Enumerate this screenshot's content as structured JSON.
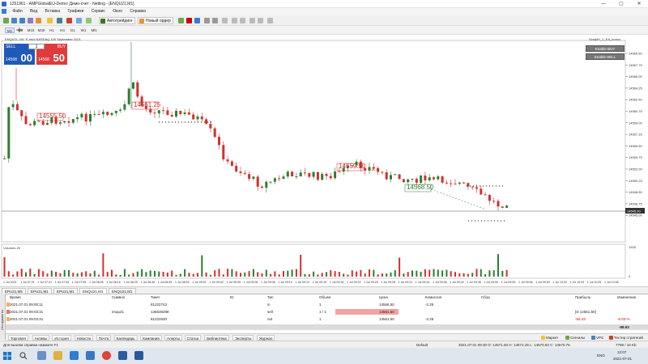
{
  "window": {
    "title": "1251961 - AMPGlobalEU-Demo: Демо-счет - Netting - [ENQU21,M1]",
    "minimize": "—",
    "maximize": "▢",
    "close": "✕"
  },
  "menu": [
    "Файл",
    "Вид",
    "Вставка",
    "Графики",
    "Сервис",
    "Окно",
    "Справка"
  ],
  "toolbar": {
    "autotrading": "Автотрейдинг",
    "new_order": "Новый ордер"
  },
  "timeframes": [
    "M1",
    "M5",
    "M15",
    "M30",
    "H1",
    "H4",
    "D1",
    "W1",
    "MN"
  ],
  "chart": {
    "title": "ENQU21, M1: E-mini NASDAQ 100 September 2021",
    "ea_label": "ScalpEr_2_EA_bonus",
    "enable_buy": "Enable BUY",
    "enable_sell": "Enable SELL",
    "volume_label": "Volumes 29",
    "oneclick": {
      "sell": "SELL",
      "buy": "BUY",
      "lot": "1",
      "sell_small": "14568",
      "sell_big": "00",
      "buy_small": "14568",
      "buy_big": "50"
    },
    "price_axis": [
      "14569.50",
      "14567.75",
      "14566.00",
      "14564.25",
      "14562.50",
      "14560.75",
      "14559.00",
      "14557.25",
      "14555.50",
      "14553.75",
      "14552.00",
      "14550.25",
      "14548.50",
      "14546.75",
      "14545.00"
    ],
    "current_price": "14545.00",
    "vol_axis": [
      "1925",
      "0"
    ],
    "time_axis": [
      "1 Jul 2021",
      "1 Jul 07:21",
      "1 Jul 07:41",
      "1 Jul 07:50",
      "1 Jul 07:59",
      "1 Jul 08:06",
      "1 Jul 08:16",
      "1 Jul 08:25",
      "1 Jul 08:36",
      "1 Jul 08:45",
      "1 Jul 08:53",
      "1 Jul 09:01",
      "1 Jul 09:02",
      "1 Jul 09:05",
      "1 Jul 09:06",
      "1 Jul 09:08",
      "1 Jul 09:10",
      "1 Jul 09:13",
      "1 Jul 09:15",
      "1 Jul 09:18",
      "1 Jul 09:22",
      "1 Jul 09:25",
      "1 Jul 09:28",
      "1 Jul 09:31",
      "1 Jul 09:34",
      "1 Jul 09:38",
      "1 Jul 09:42",
      "1 Jul 09:46",
      "1 Jul 09:50",
      "1 Jul 09:53",
      "1 Jul 09:56",
      "1 Jul 09:59",
      "1 Jul 10:02",
      "1 Jul 10:04",
      "1 Jul 10:05",
      "1 Jul 10:06"
    ],
    "trade_labels": [
      "14555.50",
      "14561.25",
      "14559.50",
      "14568.50"
    ]
  },
  "chart_tabs": [
    "EPU21,M5",
    "EPU21,M1",
    "EPU21,M1",
    "ENQU21,M1",
    "ENQU21,M1"
  ],
  "table": {
    "headers": [
      "Время",
      "Символ",
      "Тикет",
      "ID",
      "Тип",
      "Объем",
      "Цена",
      "Комиссия",
      "Сбор",
      "Прибыль",
      "Изменение"
    ],
    "rows": [
      [
        "2021.07.01 09:00:11",
        "",
        "81222743",
        "",
        "in",
        "1",
        "14566.50",
        "-2.25",
        "",
        "",
        ""
      ],
      [
        "2021.07.01 09:03:31",
        "enqu21",
        "136638288",
        "",
        "sell",
        "1 / 1",
        "14561.50",
        "",
        "",
        "[sl 14561.50]",
        ""
      ],
      [
        "2021.07.01 09:03:31",
        "",
        "81222830",
        "",
        "out",
        "1",
        "14561.50",
        "-2.25",
        "",
        "-84.43",
        "-0.03 %"
      ]
    ],
    "total": "-88.93"
  },
  "bottom_tabs": [
    "Торговля",
    "Активы",
    "История",
    "Новости",
    "Почта",
    "Календарь",
    "Компания",
    "Алерты",
    "Статьи",
    "Библиотека",
    "Эксперты",
    "Журнал"
  ],
  "right_tabs": [
    "Маркет",
    "Сигналы",
    "VPS",
    "Тестер стратегий"
  ],
  "toolbox_side": "Инструменты",
  "status": {
    "hint": "Для вызова справки нажмите F1",
    "profile": "Default",
    "ohlc": "2021.07.01 09:30  O: 14571.50  H: 14572.25  L: 14570.50  C: 14570.75",
    "net": "7798 / 10 Kb"
  },
  "taskbar": {
    "lang": "ENG",
    "time": "12:07",
    "date": "2021-07-01"
  }
}
